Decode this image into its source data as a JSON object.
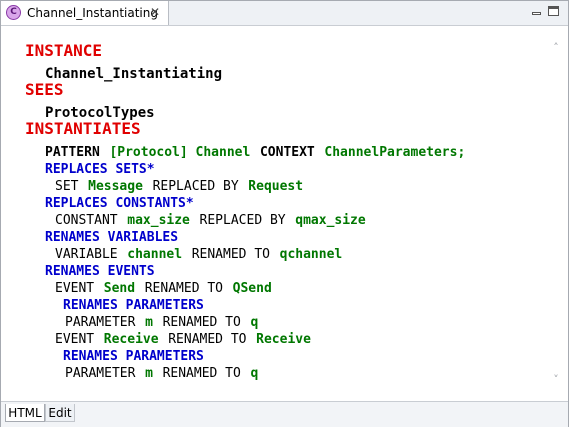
{
  "tab": {
    "title": "Channel_Instantiating",
    "icon": "machine-icon",
    "icon_glyph": "C",
    "close_glyph": "✕"
  },
  "window_buttons": {
    "minimize": "minimize-icon",
    "maximize": "maximize-icon"
  },
  "code": {
    "instance_kw": "INSTANCE",
    "instance_name": "Channel_Instantiating",
    "sees_kw": "SEES",
    "sees_name": "ProtocolTypes",
    "instantiates_kw": "INSTANTIATES",
    "pattern_kw": "PATTERN",
    "pattern_name": "[Protocol] Channel",
    "context_kw": "CONTEXT",
    "context_name": "ChannelParameters;",
    "replaces_sets_kw": "REPLACES SETS*",
    "set_kw": "SET",
    "set_name": "Message",
    "set_replaced_kw": "REPLACED BY",
    "set_target": "Request",
    "replaces_constants_kw": "REPLACES CONSTANTS*",
    "constant_kw": "CONSTANT",
    "constant_name": "max_size",
    "constant_replaced_kw": "REPLACED BY",
    "constant_target": "qmax_size",
    "renames_variables_kw": "RENAMES VARIABLES",
    "variable_kw": "VARIABLE",
    "variable_name": "channel",
    "variable_renamed_kw": "RENAMED TO",
    "variable_target": "qchannel",
    "renames_events_kw": "RENAMES EVENTS",
    "event1_kw": "EVENT",
    "event1_name": "Send",
    "event1_renamed_kw": "RENAMED TO",
    "event1_target": "QSend",
    "event1_params_kw": "RENAMES PARAMETERS",
    "param1_kw": "PARAMETER",
    "param1_name": "m",
    "param1_renamed_kw": "RENAMED TO",
    "param1_target": "q",
    "event2_kw": "EVENT",
    "event2_name": "Receive",
    "event2_renamed_kw": "RENAMED TO",
    "event2_target": "Receive",
    "event2_params_kw": "RENAMES PARAMETERS",
    "param2_kw": "PARAMETER",
    "param2_name": "m",
    "param2_renamed_kw": "RENAMED TO",
    "param2_target": "q"
  },
  "scroll": {
    "up": "˄",
    "down": "˅"
  },
  "bottom_tabs": {
    "html_label": "HTML",
    "edit_label": "Edit"
  },
  "colors": {
    "keyword_red": "#e00000",
    "keyword_blue": "#0000cc",
    "identifier_green": "#007700"
  }
}
